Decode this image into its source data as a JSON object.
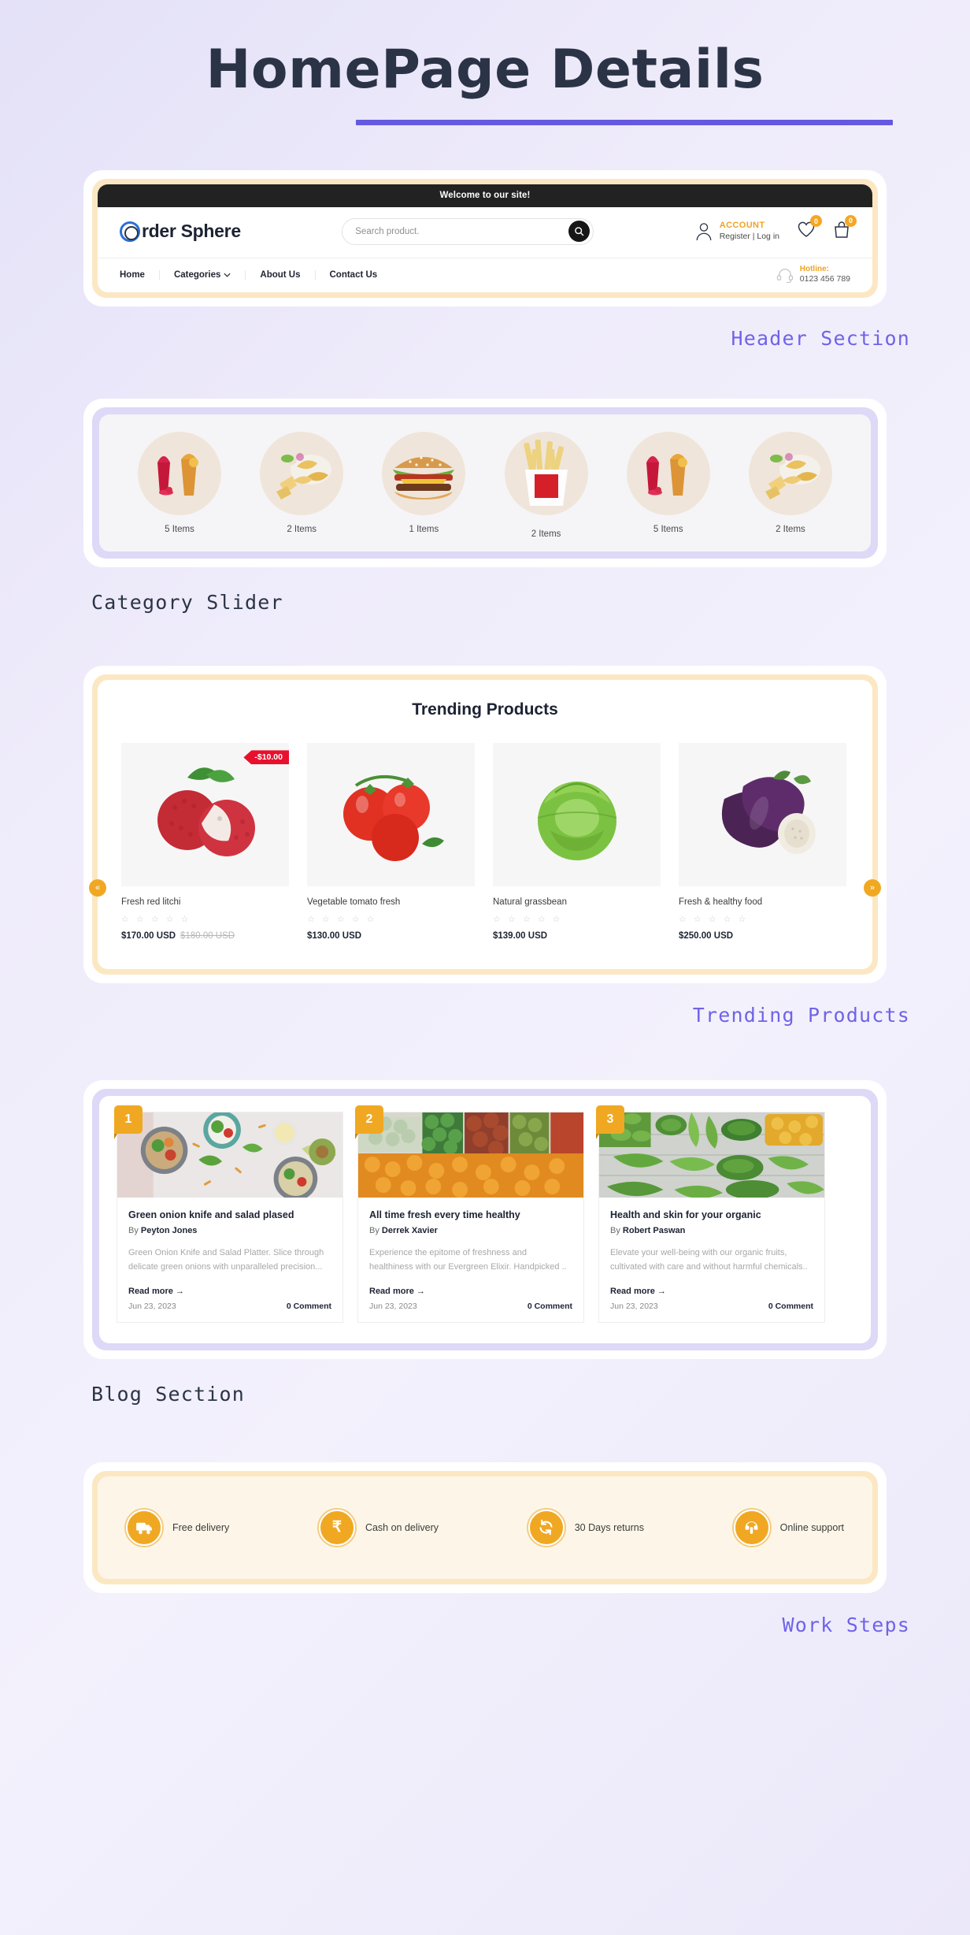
{
  "page": {
    "title": "HomePage Details"
  },
  "annotations": {
    "header": "Header Section",
    "category": "Category Slider",
    "trending": "Trending Products",
    "blog": "Blog Section",
    "work": "Work Steps"
  },
  "header": {
    "topbar_message": "Welcome to our site!",
    "brand_name": "rder Sphere",
    "search": {
      "placeholder": "Search product.",
      "value": "",
      "button_icon": "search-icon"
    },
    "account": {
      "title": "ACCOUNT",
      "subtitle": "Register | Log in",
      "icon": "user-icon"
    },
    "wishlist": {
      "icon": "heart-icon",
      "count": "0"
    },
    "cart": {
      "icon": "bag-icon",
      "count": "0"
    },
    "nav": [
      {
        "label": "Home",
        "caret": false
      },
      {
        "label": "Categories",
        "caret": true
      },
      {
        "label": "About Us",
        "caret": false
      },
      {
        "label": "Contact Us",
        "caret": false
      }
    ],
    "hotline": {
      "icon": "headset-icon",
      "label": "Hotline:",
      "number": "0123 456 789"
    }
  },
  "category_slider": {
    "items": [
      {
        "label": "5 Items",
        "image": "juice-drinks"
      },
      {
        "label": "2 Items",
        "image": "chips-cheese"
      },
      {
        "label": "1 Items",
        "image": "burger"
      },
      {
        "label": "2 Items",
        "image": "french-fries"
      },
      {
        "label": "5 Items",
        "image": "juice-drinks"
      },
      {
        "label": "2 Items",
        "image": "chips-cheese"
      }
    ]
  },
  "trending": {
    "title": "Trending Products",
    "prev_icon": "chevron-left-icon",
    "next_icon": "chevron-right-icon",
    "products": [
      {
        "name": "Fresh red litchi",
        "image": "litchi",
        "rating": "☆ ☆ ☆ ☆ ☆",
        "price": "$170.00 USD",
        "old_price": "$180.00 USD",
        "badge": "-$10.00"
      },
      {
        "name": "Vegetable tomato fresh",
        "image": "tomato",
        "rating": "☆ ☆ ☆ ☆ ☆",
        "price": "$130.00 USD",
        "old_price": "",
        "badge": ""
      },
      {
        "name": "Natural grassbean",
        "image": "cabbage",
        "rating": "☆ ☆ ☆ ☆ ☆",
        "price": "$139.00 USD",
        "old_price": "",
        "badge": ""
      },
      {
        "name": "Fresh & healthy food",
        "image": "eggplant",
        "rating": "☆ ☆ ☆ ☆ ☆",
        "price": "$250.00 USD",
        "old_price": "",
        "badge": ""
      }
    ]
  },
  "blog": {
    "posts": [
      {
        "number": "1",
        "image": "salad-bowls",
        "title": "Green onion knife and salad plased",
        "by_prefix": "By ",
        "author": "Peyton Jones",
        "excerpt": "Green Onion Knife and Salad Platter. Slice through delicate green onions with unparalleled precision...",
        "read_more": "Read more",
        "date": "Jun 23, 2023",
        "comments": "0 Comment"
      },
      {
        "number": "2",
        "image": "vegetable-market",
        "title": "All time fresh every time healthy",
        "by_prefix": "By ",
        "author": "Derrek Xavier",
        "excerpt": "Experience the epitome of freshness and healthiness with our Evergreen Elixir. Handpicked ..",
        "read_more": "Read more",
        "date": "Jun 23, 2023",
        "comments": "0 Comment"
      },
      {
        "number": "3",
        "image": "green-vegetables",
        "title": "Health and skin for your organic",
        "by_prefix": "By ",
        "author": "Robert Paswan",
        "excerpt": "Elevate your well-being with our organic fruits, cultivated with care and without harmful chemicals..",
        "read_more": "Read more",
        "date": "Jun 23, 2023",
        "comments": "0 Comment"
      }
    ]
  },
  "work_steps": {
    "items": [
      {
        "label": "Free delivery",
        "icon": "truck-icon"
      },
      {
        "label": "Cash on delivery",
        "icon": "rupee-icon"
      },
      {
        "label": "30 Days returns",
        "icon": "refresh-icon"
      },
      {
        "label": "Online support",
        "icon": "headphones-icon"
      }
    ]
  },
  "colors": {
    "accent_purple": "#6459e0",
    "accent_orange": "#f0a823",
    "cream": "#fbe8c3",
    "lilac": "#ddd9f7",
    "dark": "#2b3446",
    "sale_red": "#e8112d"
  }
}
